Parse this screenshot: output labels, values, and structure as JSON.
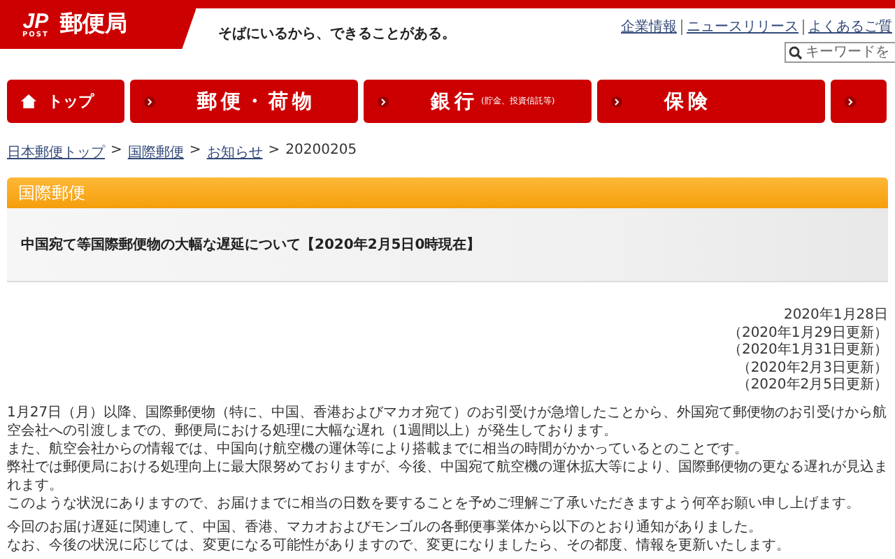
{
  "header": {
    "logo_mark": "JP",
    "logo_sub": "POST",
    "site_name": "郵便局",
    "tagline": "そばにいるから、できることがある。",
    "links": [
      "企業情報",
      "ニュースリリース",
      "よくあるご質"
    ],
    "search": {
      "placeholder": "キーワードを"
    }
  },
  "nav": [
    {
      "kind": "home",
      "label": "トップ"
    },
    {
      "kind": "item",
      "label": "郵便・荷物"
    },
    {
      "kind": "item",
      "label": "銀行",
      "note": "(貯金、投資信託等)"
    },
    {
      "kind": "item",
      "label": "保険"
    },
    {
      "kind": "partial"
    }
  ],
  "breadcrumb": {
    "links": [
      {
        "label": "日本郵便トップ",
        "separator": ">"
      },
      {
        "label": "国際郵便",
        "separator": ">"
      },
      {
        "label": "お知らせ",
        "separator": ">"
      }
    ],
    "current": "20200205"
  },
  "section": {
    "heading": "国際郵便",
    "title": "中国宛て等国際郵便物の大幅な遅延について【2020年2月5日0時現在】"
  },
  "dates": [
    "2020年1月28日",
    "（2020年1月29日更新）",
    "（2020年1月31日更新）",
    "（2020年2月3日更新）",
    "（2020年2月5日更新）"
  ],
  "paragraphs": [
    [
      "1月27日（月）以降、国際郵便物（特に、中国、香港およびマカオ宛て）のお引受けが急増したことから、外国宛て郵便物のお引受けから航空会社への引渡しまでの、郵便局における処理に大幅な遅れ（1週間以上）が発生しております。",
      "また、航空会社からの情報では、中国向け航空機の運休等により搭載までに相当の時間がかかっているとのことです。",
      "弊社では郵便局における処理向上に最大限努めておりますが、今後、中国宛て航空機の運休拡大等により、国際郵便物の更なる遅れが見込まれます。",
      "このような状況にありますので、お届けまでに相当の日数を要することを予めご理解ご了承いただきますよう何卒お願い申し上げます。"
    ],
    [
      "今回のお届け遅延に関連して、中国、香港、マカオおよびモンゴルの各郵便事業体から以下のとおり通知がありました。",
      "なお、今後の状況に応じては、変更になる可能性がありますので、変更になりましたら、その都度、情報を更新いたします。"
    ]
  ]
}
